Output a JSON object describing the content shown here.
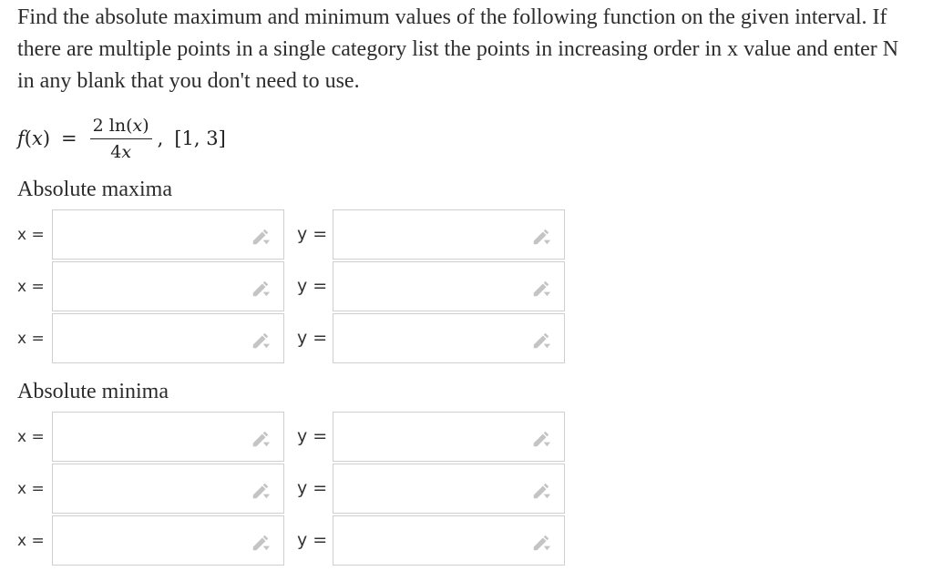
{
  "question": "Find the absolute maximum and minimum values of the following function on the given interval. If there are multiple points in a single category list the points in increasing order in x value and enter N in any blank that you don't need to use.",
  "formula": {
    "lhs_name": "f",
    "lhs_var": "x",
    "numerator_coef": "2",
    "numerator_fn": "ln",
    "numerator_var": "x",
    "denominator_coef": "4",
    "denominator_var": "x",
    "interval": "[1, 3]"
  },
  "sections": [
    {
      "title": "Absolute maxima",
      "rows": [
        {
          "x_label": "x =",
          "x_value": "",
          "y_label": "y =",
          "y_value": ""
        },
        {
          "x_label": "x =",
          "x_value": "",
          "y_label": "y =",
          "y_value": ""
        },
        {
          "x_label": "x =",
          "x_value": "",
          "y_label": "y =",
          "y_value": ""
        }
      ]
    },
    {
      "title": "Absolute minima",
      "rows": [
        {
          "x_label": "x =",
          "x_value": "",
          "y_label": "y =",
          "y_value": ""
        },
        {
          "x_label": "x =",
          "x_value": "",
          "y_label": "y =",
          "y_value": ""
        },
        {
          "x_label": "x =",
          "x_value": "",
          "y_label": "y =",
          "y_value": ""
        }
      ]
    }
  ],
  "icons": {
    "field_icon": "pencil-icon",
    "icon_color": "#c4c4c4"
  }
}
